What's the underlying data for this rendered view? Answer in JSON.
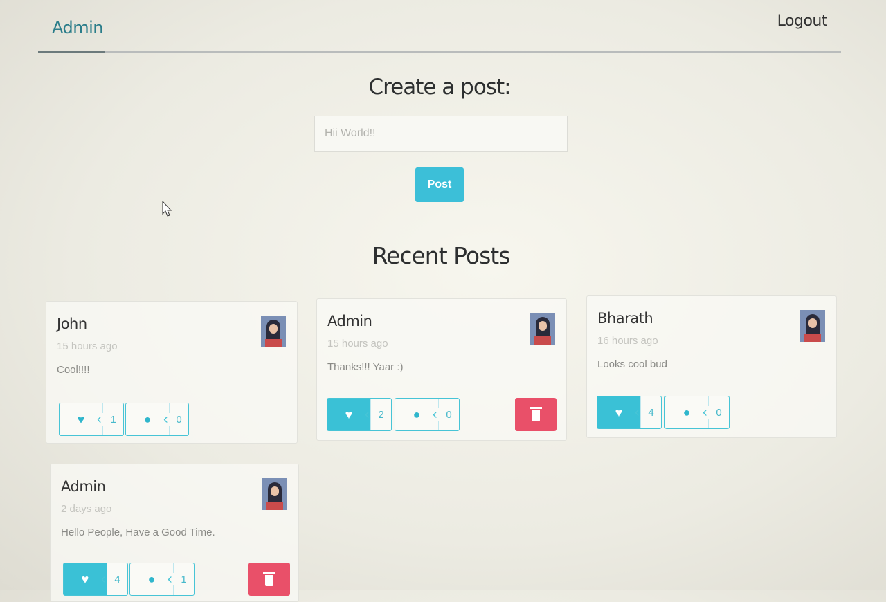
{
  "nav": {
    "brand": "Admin",
    "logout": "Logout"
  },
  "composer": {
    "title": "Create a post:",
    "placeholder": "Hii World!!",
    "post_button": "Post"
  },
  "feed": {
    "title": "Recent Posts",
    "posts": [
      {
        "author": "John",
        "time": "15 hours ago",
        "body": "Cool!!!!",
        "likes": "1",
        "comments": "0",
        "liked": false,
        "deletable": false
      },
      {
        "author": "Admin",
        "time": "15 hours ago",
        "body": "Thanks!!! Yaar :)",
        "likes": "2",
        "comments": "0",
        "liked": true,
        "deletable": true
      },
      {
        "author": "Bharath",
        "time": "16 hours ago",
        "body": "Looks cool bud",
        "likes": "4",
        "comments": "0",
        "liked": true,
        "deletable": false
      },
      {
        "author": "Admin",
        "time": "2 days ago",
        "body": "Hello People, Have a Good Time.",
        "likes": "4",
        "comments": "1",
        "liked": true,
        "deletable": true
      }
    ]
  },
  "colors": {
    "accent": "#3ac1d6",
    "danger": "#e95069",
    "brand": "#2b7d8a"
  },
  "icons": [
    "heart-icon",
    "comment-icon",
    "trash-icon",
    "avatar-image"
  ]
}
